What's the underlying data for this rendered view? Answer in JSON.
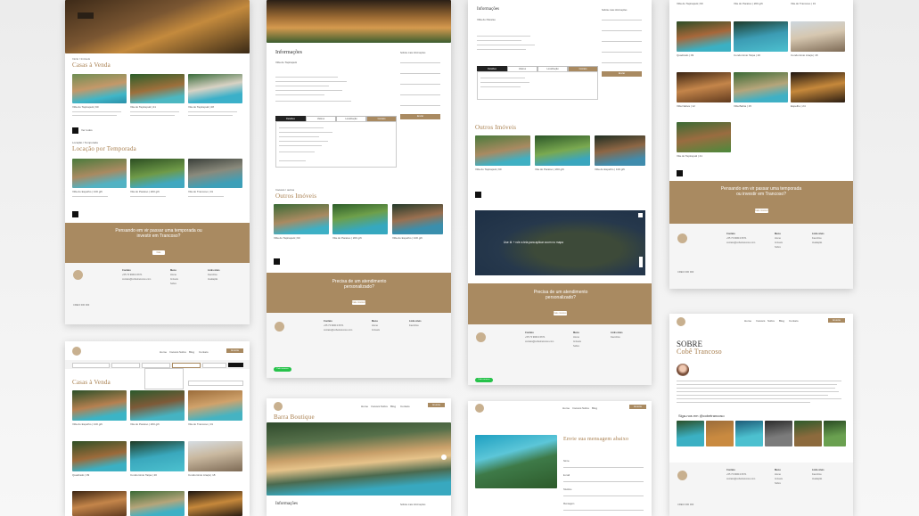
{
  "section_houses_sale": "Casas à Venda",
  "section_rental": "Locação por Temporada",
  "section_other": "Outros Imóveis",
  "info_title": "Informações",
  "contact_side_title": "Solicite mais informações",
  "banner_text": "Pensando em vir passar uma temporada ou investir em Trancoso?",
  "banner_text_2": "Precisa de um atendimento personalizado?",
  "banner_button": "Fale conosco",
  "about_title": "SOBRE",
  "about_subtitle": "Cobê Trancoso",
  "instagram_label": "Siga-nos em @cobetrancoso",
  "barra_title": "Barra Boutique",
  "contact_page_title": "Envie sua mensagem abaixo",
  "map_overlay": "Use ⌘ + role a tela para aplicar zoom no mapa",
  "whatsapp_label": "Fale conosco",
  "creci": "CRECI 000 000",
  "listing_labels": [
    "Villa do Tapirapuã | 90",
    "Vila do Tapirapuã | 41",
    "Vila do Tapirapuã | 28",
    "Villa do Espelho | 100 gift",
    "Vila do Paraíso | 200 gift",
    "Vila do Trancoso | 31",
    "Quadrado | 09",
    "Condomínio Taipa | 20",
    "Condomínio Araçá | 18",
    "Villa Nativa | 12",
    "Villa Bahia | 15",
    "Espelho | 24"
  ],
  "footer": {
    "contact_head": "Contato",
    "phone": "+55 73 99613 6671",
    "email": "contato@cobetrancoso.com",
    "menu_head": "Menu",
    "menu_items": [
      "Home",
      "Imóveis",
      "Sobre",
      "Contato"
    ],
    "links_head": "Links úteis",
    "link_items": [
      "Favoritos",
      "Avaliação",
      "Locação"
    ]
  },
  "nav_items": [
    "Home",
    "Imóveis",
    "Sobre",
    "Blog",
    "Contato"
  ],
  "nav_button": "Anuncie",
  "tabs": [
    "Detalhes",
    "Valores",
    "Localização",
    "Contato"
  ],
  "form_labels": [
    "Nome",
    "E-mail",
    "Telefone",
    "Mensagem"
  ],
  "form_button": "Enviar",
  "filters_label": "Buscar imóveis",
  "colors": {
    "accent": "#a98a61",
    "dark": "#1a1a1a",
    "wa": "#26c24a"
  }
}
